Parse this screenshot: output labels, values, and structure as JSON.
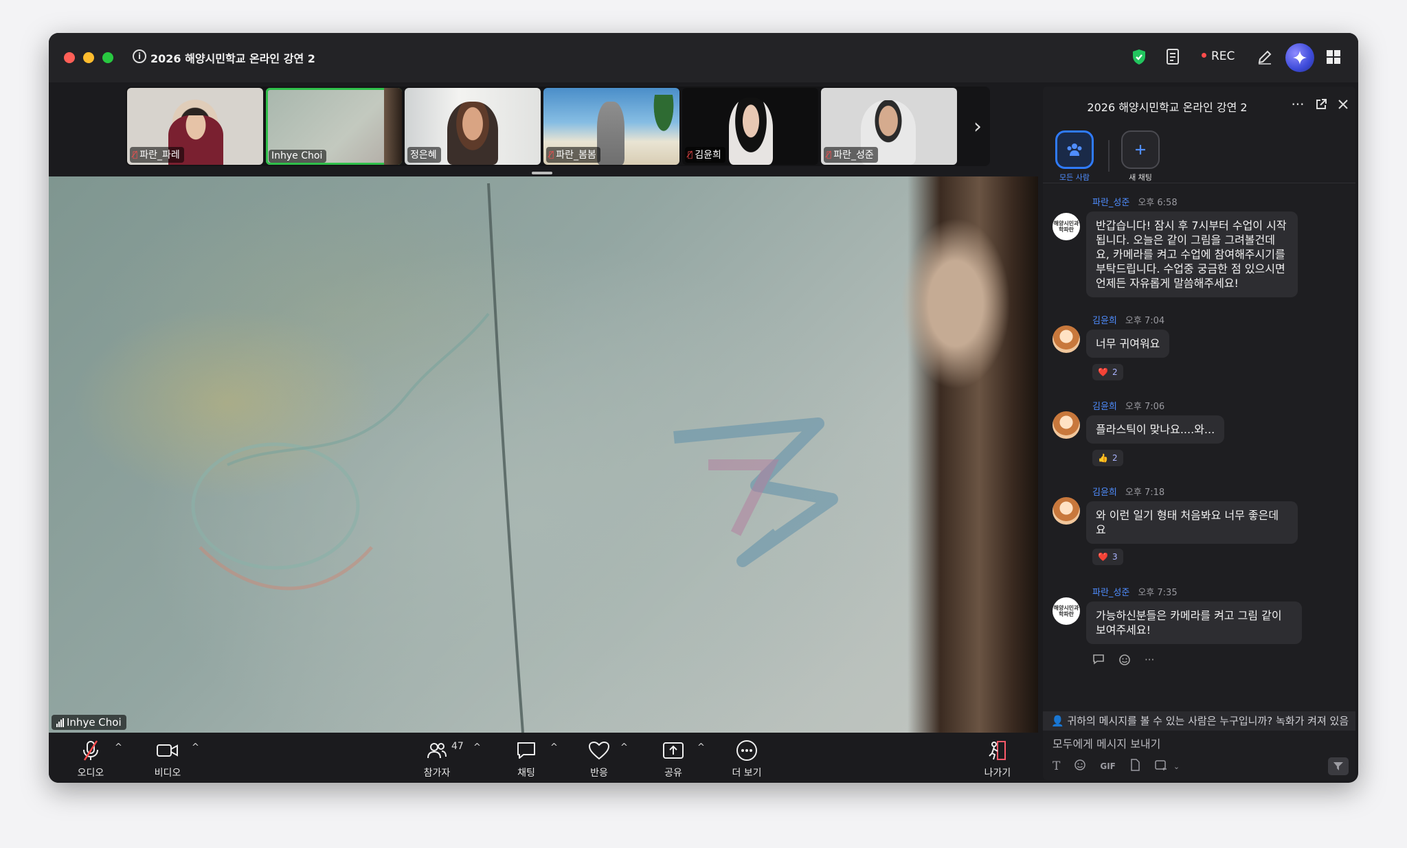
{
  "window": {
    "title": "2026 해양시민학교 온라인 강연 2",
    "rec_label": "REC"
  },
  "thumbnails": [
    {
      "name": "파란_파레",
      "muted": true
    },
    {
      "name": "Inhye Choi",
      "muted": false,
      "active": true
    },
    {
      "name": "정은혜",
      "muted": false
    },
    {
      "name": "파란_봄봄",
      "muted": true
    },
    {
      "name": "김윤희",
      "muted": true
    },
    {
      "name": "파란_성준",
      "muted": true
    }
  ],
  "main_video": {
    "speaker": "Inhye Choi"
  },
  "toolbar": {
    "audio": "오디오",
    "video": "비디오",
    "participants": "참가자",
    "participants_count": "47",
    "chat": "채팅",
    "reactions": "반응",
    "share": "공유",
    "more": "더 보기",
    "leave": "나가기"
  },
  "chat": {
    "title": "2026 해양시민학교 온라인 강연 2",
    "tab_all": "모든 사람",
    "tab_new": "새 채팅",
    "messages": [
      {
        "sender": "파란_성준",
        "time": "오후 6:58",
        "text": "반갑습니다! 잠시 후 7시부터 수업이 시작됩니다. 오늘은 같이 그림을 그려볼건데요, 카메라를 켜고 수업에 참여해주시기를 부탁드립니다. 수업중 궁금한 점 있으시면 언제든 자유롭게 말씀해주세요!"
      },
      {
        "sender": "김윤희",
        "time": "오후 7:04",
        "text": "너무 귀여워요",
        "reaction": "❤️",
        "reaction_count": "2"
      },
      {
        "sender": "김윤희",
        "time": "오후 7:06",
        "text": "플라스틱이 맞나요....와...",
        "reaction": "👍",
        "reaction_count": "2"
      },
      {
        "sender": "김윤희",
        "time": "오후 7:18",
        "text": "와 이런 일기 형태 처음봐요 너무 좋은데요",
        "reaction": "❤️",
        "reaction_count": "3"
      },
      {
        "sender": "파란_성준",
        "time": "오후 7:35",
        "text": "가능하신분들은 카메라를 켜고 그림 같이 보여주세요!"
      }
    ],
    "avatar_logo_text": "해양시민과학파란",
    "notice": "귀하의 메시지를 볼 수 있는 사람은 누구입니까? 녹화가 켜져 있음",
    "input_placeholder": "모두에게 메시지 보내기",
    "composer_gif": "GIF"
  },
  "colors": {
    "accent": "#2f7bff",
    "active_speaker": "#2fbf4a",
    "muted": "#ff4d4d",
    "sender_name": "#4f8dff"
  }
}
